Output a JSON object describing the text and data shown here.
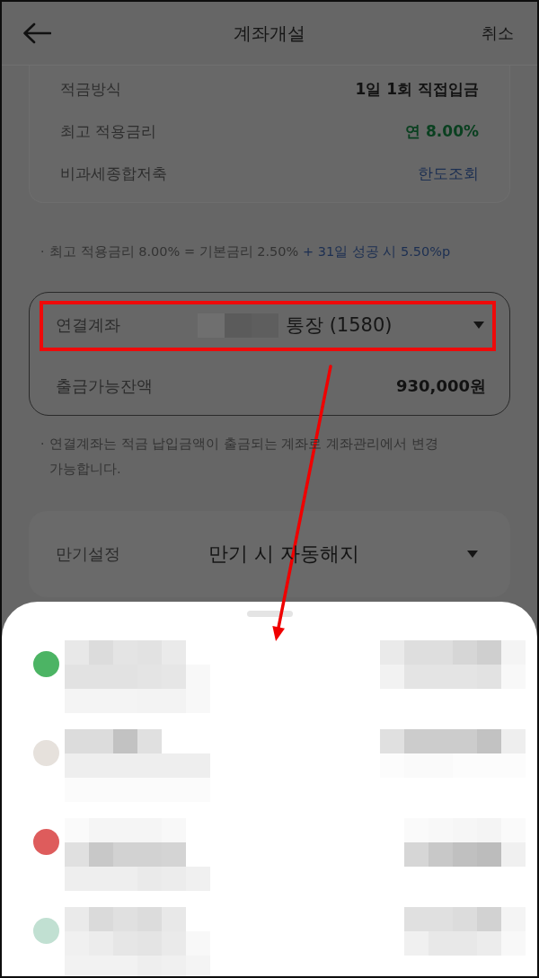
{
  "header": {
    "title": "계좌개설",
    "cancel": "취소"
  },
  "summary": [
    {
      "label": "적금방식",
      "value": "1일 1회 직접입금",
      "kind": "plain"
    },
    {
      "label": "최고 적용금리",
      "value": "연 8.00%",
      "kind": "rate"
    },
    {
      "label": "비과세종합저축",
      "value": "한도조회",
      "kind": "link"
    }
  ],
  "rate_note": {
    "bullet": "·",
    "text": "최고 적용금리 8.00% = 기본금리 2.50%",
    "highlight": "+ 31일 성공 시 5.50%p"
  },
  "linked_account": {
    "label": "연결계좌",
    "account": "통장 (1580)",
    "balance_label": "출금가능잔액",
    "balance": "930,000원"
  },
  "account_note": {
    "bullet": "·",
    "text": "연결계좌는 적금 납입금액이 출금되는 계좌로 계좌관리에서 변경 가능합니다."
  },
  "maturity": {
    "label": "만기설정",
    "value": "만기 시 자동해지"
  },
  "account_sheet": {
    "accounts": [
      {
        "color": "#4cb464"
      },
      {
        "color": "#e6e1dc"
      },
      {
        "color": "#de5c5c"
      },
      {
        "color": "#c1e0d2"
      }
    ]
  }
}
